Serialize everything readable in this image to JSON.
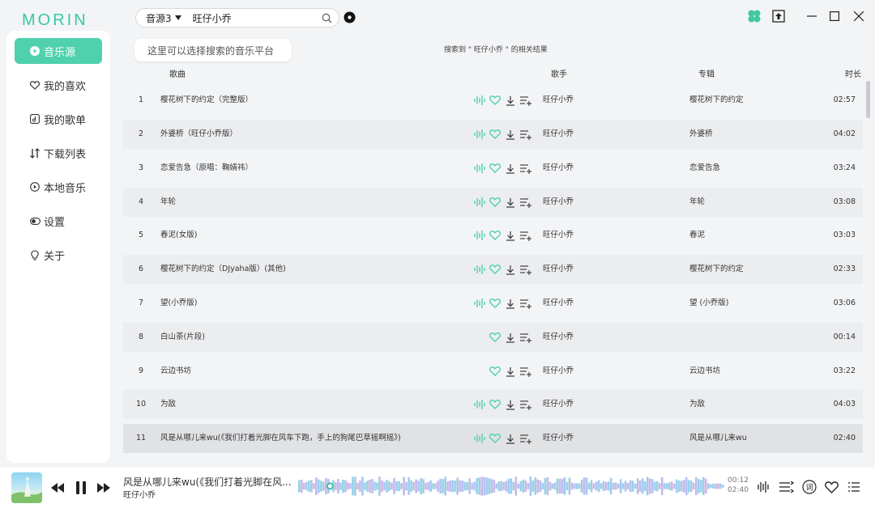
{
  "app": {
    "logo_text": "MORIN"
  },
  "sidebar": {
    "items": [
      {
        "label": "音乐源",
        "icon": "music-source-icon",
        "active": true
      },
      {
        "label": "我的喜欢",
        "icon": "heart-icon"
      },
      {
        "label": "我的歌单",
        "icon": "playlist-icon"
      },
      {
        "label": "下载列表",
        "icon": "download-list-icon"
      },
      {
        "label": "本地音乐",
        "icon": "local-music-icon"
      },
      {
        "label": "设置",
        "icon": "toggle-icon"
      },
      {
        "label": "关于",
        "icon": "bulb-icon"
      }
    ]
  },
  "search": {
    "source": "音源3",
    "query": "旺仔小乔",
    "tooltip": "这里可以选择搜索的音乐平台",
    "result_text": "搜索到 \" 旺仔小乔 \" 的相关结果"
  },
  "table": {
    "headers": {
      "song": "歌曲",
      "artist": "歌手",
      "album": "专辑",
      "duration": "时长"
    },
    "rows": [
      {
        "num": "1",
        "title": "樱花树下的约定（完整版）",
        "artist": "旺仔小乔",
        "album": "樱花树下的约定",
        "duration": "02:57",
        "quality": true
      },
      {
        "num": "2",
        "title": "外婆桥（旺仔小乔版）",
        "artist": "旺仔小乔",
        "album": "外婆桥",
        "duration": "04:02",
        "quality": true
      },
      {
        "num": "3",
        "title": "恋爱告急（原唱：鞠婧祎）",
        "artist": "旺仔小乔",
        "album": "恋爱告急",
        "duration": "03:24",
        "quality": true
      },
      {
        "num": "4",
        "title": "年轮",
        "artist": "旺仔小乔",
        "album": "年轮",
        "duration": "03:08",
        "quality": true
      },
      {
        "num": "5",
        "title": "春泥(女版)",
        "artist": "旺仔小乔",
        "album": "春泥",
        "duration": "03:03",
        "quality": true
      },
      {
        "num": "6",
        "title": "樱花树下的约定（DJyaha版）(其他)",
        "artist": "旺仔小乔",
        "album": "樱花树下的约定",
        "duration": "02:33",
        "quality": true
      },
      {
        "num": "7",
        "title": "望(小乔版)",
        "artist": "旺仔小乔",
        "album": "望 (小乔版)",
        "duration": "03:06",
        "quality": true
      },
      {
        "num": "8",
        "title": "白山茶(片段)",
        "artist": "旺仔小乔",
        "album": "",
        "duration": "00:14",
        "quality": false
      },
      {
        "num": "9",
        "title": "云边书坊",
        "artist": "旺仔小乔",
        "album": "云边书坊",
        "duration": "03:22",
        "quality": false
      },
      {
        "num": "10",
        "title": "为敌",
        "artist": "旺仔小乔",
        "album": "为敌",
        "duration": "04:03",
        "quality": true
      },
      {
        "num": "11",
        "title": "风是从哪儿来wu(《我们打着光脚在风车下跑，手上的狗尾巴草摇啊摇》)",
        "artist": "旺仔小乔",
        "album": "风是从哪儿来wu",
        "duration": "02:40",
        "quality": true
      }
    ]
  },
  "player": {
    "title": "风是从哪儿来wu(《我们打着光脚在风...",
    "artist": "旺仔小乔",
    "elapsed": "00:12",
    "total": "02:40",
    "progress": 0.075
  },
  "colors": {
    "accent": "#4fd1ad",
    "sidebar_active": "#4fd1ad"
  }
}
